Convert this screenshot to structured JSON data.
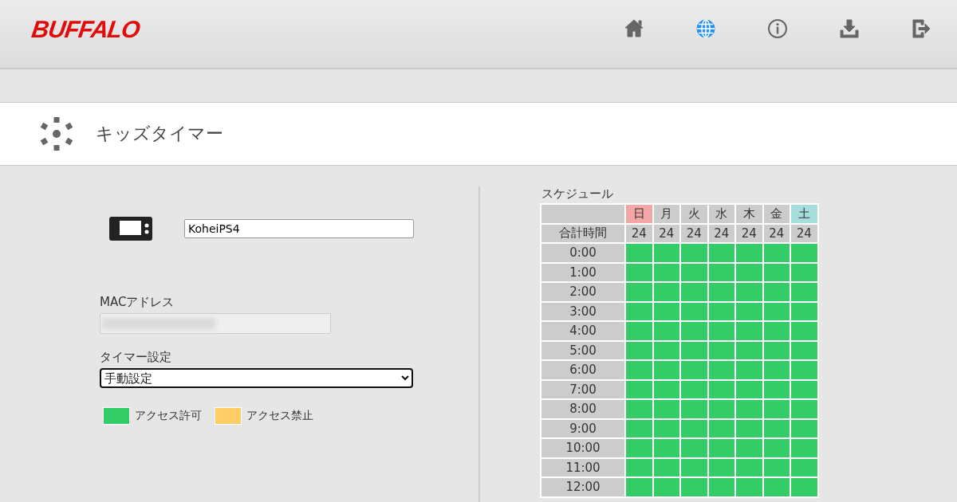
{
  "header": {
    "logo": "BUFFALO",
    "nav": [
      {
        "kind": "home",
        "selected": false
      },
      {
        "kind": "globe",
        "selected": true
      },
      {
        "kind": "info",
        "selected": false
      },
      {
        "kind": "download",
        "selected": false
      },
      {
        "kind": "logout",
        "selected": false
      }
    ]
  },
  "page_title": "キッズタイマー",
  "device": {
    "name": "KoheiPS4",
    "mac_label": "MACアドレス",
    "timer_label": "タイマー設定",
    "timer_value": "手動設定"
  },
  "legend": [
    {
      "label": "アクセス許可",
      "color": "#33cc66"
    },
    {
      "label": "アクセス禁止",
      "color": "#ffcc66"
    }
  ],
  "schedule": {
    "title": "スケジュール",
    "total_label": "合計時間",
    "days": [
      {
        "label": "日",
        "total": "24",
        "color": "#f4a6a6"
      },
      {
        "label": "月",
        "total": "24",
        "color": "#cccccc"
      },
      {
        "label": "火",
        "total": "24",
        "color": "#cccccc"
      },
      {
        "label": "水",
        "total": "24",
        "color": "#cccccc"
      },
      {
        "label": "木",
        "total": "24",
        "color": "#cccccc"
      },
      {
        "label": "金",
        "total": "24",
        "color": "#cccccc"
      },
      {
        "label": "土",
        "total": "24",
        "color": "#a6dede"
      }
    ],
    "rows": [
      {
        "time": "0:00",
        "allowed": [
          true,
          true,
          true,
          true,
          true,
          true,
          true
        ]
      },
      {
        "time": "1:00",
        "allowed": [
          true,
          true,
          true,
          true,
          true,
          true,
          true
        ]
      },
      {
        "time": "2:00",
        "allowed": [
          true,
          true,
          true,
          true,
          true,
          true,
          true
        ]
      },
      {
        "time": "3:00",
        "allowed": [
          true,
          true,
          true,
          true,
          true,
          true,
          true
        ]
      },
      {
        "time": "4:00",
        "allowed": [
          true,
          true,
          true,
          true,
          true,
          true,
          true
        ]
      },
      {
        "time": "5:00",
        "allowed": [
          true,
          true,
          true,
          true,
          true,
          true,
          true
        ]
      },
      {
        "time": "6:00",
        "allowed": [
          true,
          true,
          true,
          true,
          true,
          true,
          true
        ]
      },
      {
        "time": "7:00",
        "allowed": [
          true,
          true,
          true,
          true,
          true,
          true,
          true
        ]
      },
      {
        "time": "8:00",
        "allowed": [
          true,
          true,
          true,
          true,
          true,
          true,
          true
        ]
      },
      {
        "time": "9:00",
        "allowed": [
          true,
          true,
          true,
          true,
          true,
          true,
          true
        ]
      },
      {
        "time": "10:00",
        "allowed": [
          true,
          true,
          true,
          true,
          true,
          true,
          true
        ]
      },
      {
        "time": "11:00",
        "allowed": [
          true,
          true,
          true,
          true,
          true,
          true,
          true
        ]
      },
      {
        "time": "12:00",
        "allowed": [
          true,
          true,
          true,
          true,
          true,
          true,
          true
        ]
      }
    ]
  }
}
